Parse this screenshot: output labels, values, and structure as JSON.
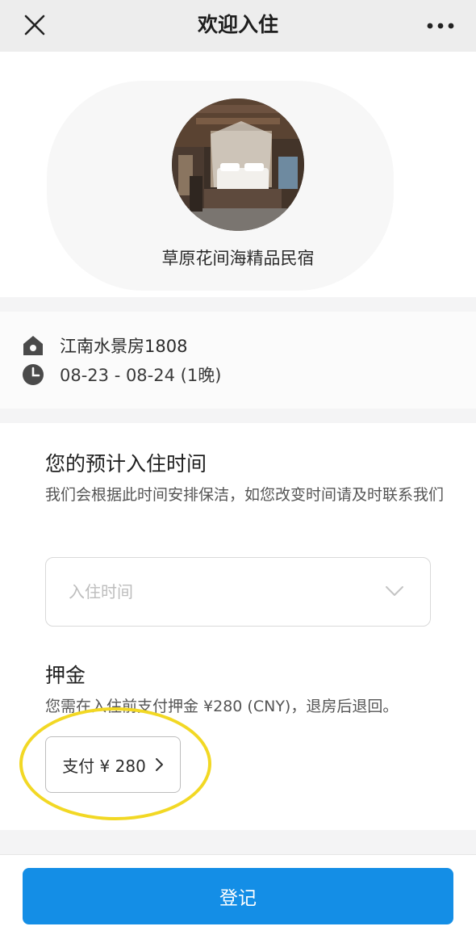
{
  "nav": {
    "title": "欢迎入住",
    "close_icon": "close-icon",
    "more_icon": "more-icon"
  },
  "hero": {
    "hotel_name": "草原花间海精品民宿",
    "avatar_icon": "hotel-room-photo"
  },
  "info": {
    "room": "江南水景房1808",
    "dates": "08-23 - 08-24 (1晚)",
    "room_icon": "home-icon",
    "dates_icon": "clock-icon"
  },
  "checkin": {
    "heading": "您的预计入住时间",
    "description": "我们会根据此时间安排保洁，如您改变时间请及时联系我们",
    "select_placeholder": "入住时间"
  },
  "deposit": {
    "heading": "押金",
    "description": "您需在入住前支付押金 ¥280 (CNY)，退房后退回。",
    "pay_button": "支付 ¥ 280"
  },
  "footer": {
    "submit_label": "登记"
  },
  "colors": {
    "primary": "#148ee6",
    "highlight": "#f2d824",
    "nav_bg": "#ededed"
  }
}
